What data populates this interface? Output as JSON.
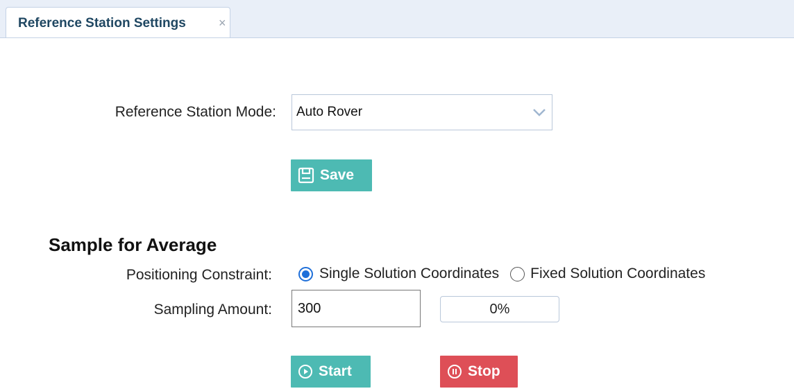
{
  "tabs": [
    {
      "label": "Reference Station Settings",
      "close": "×"
    }
  ],
  "mode": {
    "label": "Reference Station Mode:",
    "value": "Auto Rover"
  },
  "buttons": {
    "save": "Save",
    "start": "Start",
    "stop": "Stop"
  },
  "sample": {
    "heading": "Sample for Average",
    "constraint_label": "Positioning Constraint:",
    "options": [
      {
        "label": "Single Solution Coordinates",
        "selected": true
      },
      {
        "label": "Fixed Solution Coordinates",
        "selected": false
      }
    ],
    "amount_label": "Sampling Amount:",
    "amount_value": "300",
    "progress_text": "0%",
    "progress": 0
  },
  "colors": {
    "save_button": "#4dbab3",
    "start_button": "#4dbab3",
    "stop_button": "#de4f57",
    "radio_selected": "#1e6fd9",
    "tab_title": "#1f4762"
  },
  "icons": {
    "save": "floppy-disk-icon",
    "start": "play-circle-icon",
    "stop": "pause-circle-icon",
    "select": "chevron-down-icon",
    "tab_close": "close-icon"
  }
}
